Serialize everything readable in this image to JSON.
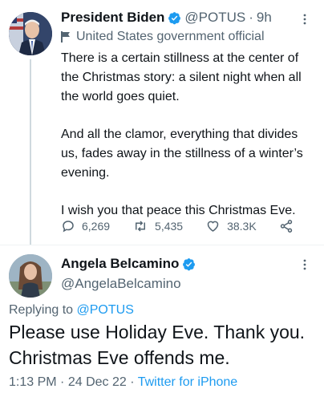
{
  "tweet": {
    "author_name": "President Biden",
    "handle": "@POTUS",
    "separator": "·",
    "time_ago": "9h",
    "gov_label": "United States government official",
    "paragraphs": [
      "There is a certain stillness at the center of the Christmas story: a silent night when all the world goes quiet.",
      "And all the clamor, everything that divides us, fades away in the stillness of a winter’s evening.",
      "I wish you that peace this Christmas Eve."
    ],
    "replies_count": "6,269",
    "retweets_count": "5,435",
    "likes_count": "38.3K",
    "icons": [
      "verified-badge-icon",
      "flag-icon",
      "reply-icon",
      "retweet-icon",
      "like-icon",
      "share-icon",
      "more-icon"
    ]
  },
  "reply": {
    "author_name": "Angela Belcamino",
    "handle": "@AngelaBelcamino",
    "replying_prefix": "Replying to",
    "replying_to": "@POTUS",
    "text": "Please use Holiday Eve. Thank you. Christmas Eve offends me.",
    "time": "1:13 PM",
    "date": "24 Dec 22",
    "separator": "·",
    "source": "Twitter for iPhone"
  },
  "colors": {
    "accent": "#1d9bf0",
    "text": "#0f1419",
    "secondary": "#536471"
  }
}
